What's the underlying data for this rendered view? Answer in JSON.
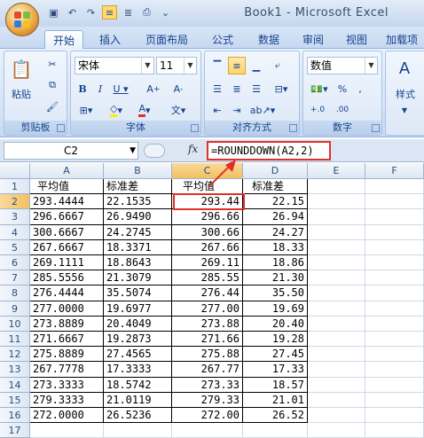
{
  "title_bar": {
    "window_title": "Book1 - Microsoft Excel"
  },
  "quick_access": [
    {
      "icon": "save-icon",
      "glyph": "▣"
    },
    {
      "icon": "undo-icon",
      "glyph": "↶"
    },
    {
      "icon": "redo-icon",
      "glyph": "↷"
    },
    {
      "icon": "align-icon",
      "glyph": "≡"
    },
    {
      "icon": "align-center-icon",
      "glyph": "≣"
    },
    {
      "icon": "print-preview-icon",
      "glyph": "⎙"
    },
    {
      "icon": "customize-icon",
      "glyph": "⌄"
    }
  ],
  "tabs": [
    "开始",
    "插入",
    "页面布局",
    "公式",
    "数据",
    "审阅",
    "视图",
    "加载项"
  ],
  "ribbon": {
    "clipboard": {
      "label": "剪贴板",
      "paste": "粘贴"
    },
    "font": {
      "label": "字体",
      "font_name": "宋体",
      "font_size": "11"
    },
    "alignment": {
      "label": "对齐方式"
    },
    "number": {
      "label": "数字",
      "format": "数值"
    },
    "styles": {
      "label": "样式"
    }
  },
  "formula_bar": {
    "name_box": "C2",
    "fx": "fx",
    "formula": "=ROUNDDOWN(A2,2)"
  },
  "sheet": {
    "columns": [
      "A",
      "B",
      "C",
      "D",
      "E",
      "F"
    ],
    "rows": [
      [
        "平均值",
        "标准差",
        "平均值",
        "标准差"
      ],
      [
        "293.4444",
        "22.1535",
        "293.44",
        "22.15"
      ],
      [
        "296.6667",
        "26.9490",
        "296.66",
        "26.94"
      ],
      [
        "300.6667",
        "24.2745",
        "300.66",
        "24.27"
      ],
      [
        "267.6667",
        "18.3371",
        "267.66",
        "18.33"
      ],
      [
        "269.1111",
        "18.8643",
        "269.11",
        "18.86"
      ],
      [
        "285.5556",
        "21.3079",
        "285.55",
        "21.30"
      ],
      [
        "276.4444",
        "35.5074",
        "276.44",
        "35.50"
      ],
      [
        "277.0000",
        "19.6977",
        "277.00",
        "19.69"
      ],
      [
        "273.8889",
        "20.4049",
        "273.88",
        "20.40"
      ],
      [
        "271.6667",
        "19.2873",
        "271.66",
        "19.28"
      ],
      [
        "275.8889",
        "27.4565",
        "275.88",
        "27.45"
      ],
      [
        "267.7778",
        "17.3333",
        "267.77",
        "17.33"
      ],
      [
        "273.3333",
        "18.5742",
        "273.33",
        "18.57"
      ],
      [
        "279.3333",
        "21.0119",
        "279.33",
        "21.01"
      ],
      [
        "272.0000",
        "26.5236",
        "272.00",
        "26.52"
      ],
      [
        "",
        "",
        "",
        ""
      ]
    ],
    "row_numbers": [
      "1",
      "2",
      "3",
      "4",
      "5",
      "6",
      "7",
      "8",
      "9",
      "10",
      "11",
      "12",
      "13",
      "14",
      "15",
      "16",
      "17"
    ],
    "active_cell": "C2"
  },
  "colors": {
    "highlight": "#e0302a",
    "ribbon_blue": "#15428b"
  }
}
